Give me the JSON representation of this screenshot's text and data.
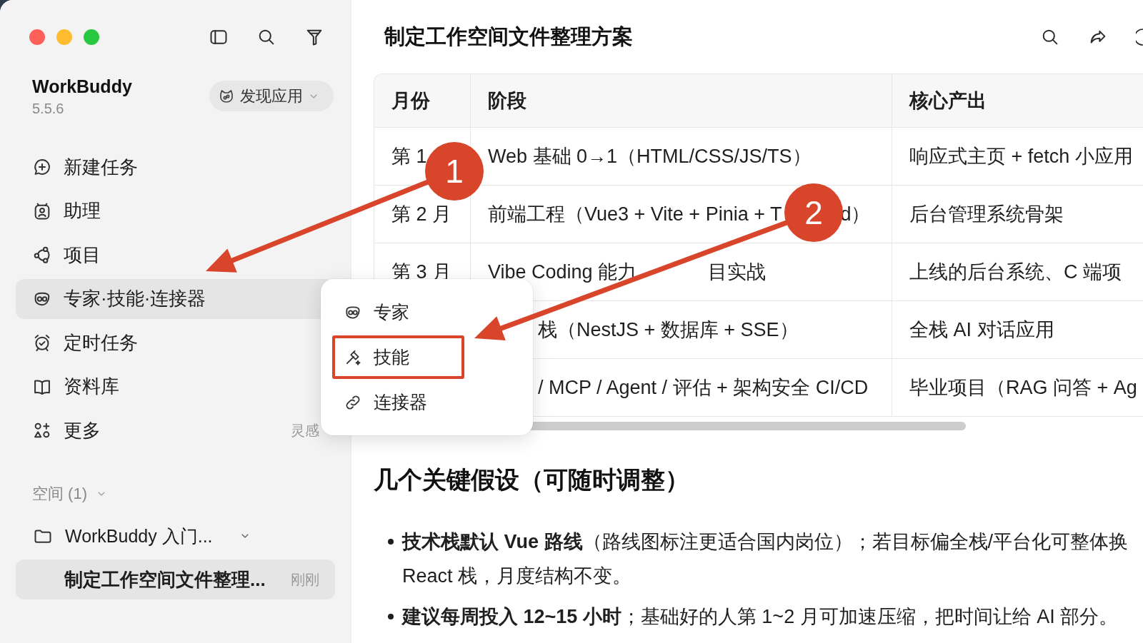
{
  "sidebar": {
    "app_name": "WorkBuddy",
    "version": "5.5.6",
    "discover_button": "发现应用",
    "nav": [
      {
        "label": "新建任务",
        "selected": false
      },
      {
        "label": "助理",
        "selected": false
      },
      {
        "label": "项目",
        "selected": false
      },
      {
        "label": "专家·技能·连接器",
        "selected": true
      },
      {
        "label": "定时任务",
        "selected": false
      },
      {
        "label": "资料库",
        "selected": false
      },
      {
        "label": "更多",
        "selected": false,
        "hint": "灵感"
      }
    ],
    "spaces": {
      "title": "空间 (1)",
      "expanded": true,
      "items": [
        {
          "name": "WorkBuddy 入门...",
          "expanded": true,
          "children": [
            {
              "title": "制定工作空间文件整理...",
              "time": "刚刚",
              "selected": true
            }
          ]
        }
      ]
    }
  },
  "document": {
    "title": "制定工作空间文件整理方案",
    "table": {
      "columns": [
        "月份",
        "阶段",
        "核心产出"
      ],
      "rows": [
        {
          "month": "第 1",
          "stage": "Web 基础 0→1（HTML/CSS/JS/TS）",
          "stage_starts_under_menu": false,
          "output": "响应式主页 + fetch 小应用"
        },
        {
          "month": "第 2 月",
          "stage": [
            "前端工程（Vue3 + Vite + Pinia + T",
            "d）"
          ],
          "stage_starts_under_menu": false,
          "output": "后台管理系统骨架"
        },
        {
          "month": "第 3 月",
          "stage": [
            "Vibe Coding 能力",
            "目实战"
          ],
          "stage_starts_under_menu": false,
          "output": "上线的后台系统、C 端项"
        },
        {
          "stage": "栈（NestJS + 数据库 + SSE）",
          "stage_starts_under_menu": true,
          "output": "全栈 AI 对话应用"
        },
        {
          "stage": "/ MCP / Agent / 评估 + 架构安全 CI/CD",
          "stage_starts_under_menu": true,
          "output": "毕业项目（RAG 问答 + Ag"
        }
      ]
    },
    "section_heading": "几个关键假设（可随时调整）",
    "bullets": [
      "**技术栈默认 Vue 路线**（路线图标注更适合国内岗位）；若目标偏全栈/平台化可整体换 React 栈，月度结构不变。",
      "**建议每周投入 12~15 小时**；基础好的人第 1~2 月可加速压缩，把时间让给 AI 部分。"
    ]
  },
  "flyout_menu": {
    "items": [
      {
        "label": "专家",
        "highlighted": false
      },
      {
        "label": "技能",
        "highlighted": true
      },
      {
        "label": "连接器",
        "highlighted": false
      }
    ]
  },
  "annotations": [
    {
      "label": "1"
    },
    {
      "label": "2"
    }
  ]
}
